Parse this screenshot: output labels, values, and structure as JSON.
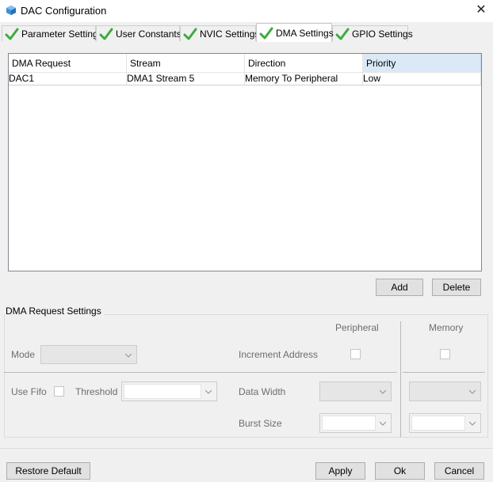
{
  "window": {
    "title": "DAC Configuration",
    "close_glyph": "✕"
  },
  "tabs": [
    {
      "label": "Parameter Settings",
      "active": false
    },
    {
      "label": "User Constants",
      "active": false
    },
    {
      "label": "NVIC Settings",
      "active": false
    },
    {
      "label": "DMA Settings",
      "active": true
    },
    {
      "label": "GPIO Settings",
      "active": false
    }
  ],
  "table": {
    "columns": [
      "DMA Request",
      "Stream",
      "Direction",
      "Priority"
    ],
    "rows": [
      [
        "DAC1",
        "DMA1 Stream 5",
        "Memory To Peripheral",
        "Low"
      ]
    ]
  },
  "table_buttons": {
    "add": "Add",
    "delete": "Delete"
  },
  "dma_request_settings": {
    "title": "DMA Request Settings",
    "peripheral_header": "Peripheral",
    "memory_header": "Memory",
    "mode_label": "Mode",
    "increment_address_label": "Increment Address",
    "use_fifo_label": "Use Fifo",
    "threshold_label": "Threshold",
    "data_width_label": "Data Width",
    "burst_size_label": "Burst Size"
  },
  "footer": {
    "restore_default": "Restore Default",
    "apply": "Apply",
    "ok": "Ok",
    "cancel": "Cancel"
  },
  "colors": {
    "check_green": "#3dab3d",
    "header_selected": "#dbe9f7"
  }
}
